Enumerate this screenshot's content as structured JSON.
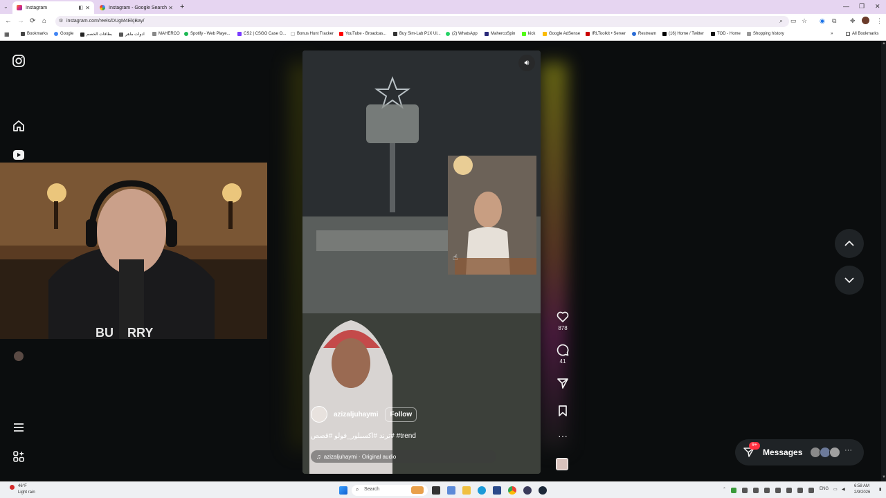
{
  "browser": {
    "tabs": [
      {
        "title": "Instagram",
        "active": true
      },
      {
        "title": "Instagram - Google Search",
        "active": false
      }
    ],
    "url": "instagram.com/reels/DUgM4EkjBay/",
    "bookmarks": [
      "Bookmarks",
      "Google",
      "بطاقات الخصم",
      "ادوات ماهر",
      "MAHERCO",
      "Spotify - Web Playe...",
      "CS2 | CSGO Case O...",
      "Bonus Hunt Tracker",
      "YouTube - Broadcas...",
      "Buy Sim-Lab P1X Ul...",
      "(2) WhatsApp",
      "MahercoSpin",
      "kick",
      "Google AdSense",
      "IRLToolkit • Server",
      "Restream",
      "(16) Home / Twitter",
      "TOD - Home",
      "Shopping history"
    ],
    "all_bookmarks": "All Bookmarks"
  },
  "webcam": {
    "shirt_text": "BU    RRY"
  },
  "reel": {
    "username": "azizaljuhaymi",
    "follow_label": "Follow",
    "caption": "ترند #اكسبلور_فولو #قصص# #trend",
    "audio": "azizaljuhaymi · Original audio"
  },
  "actions": {
    "likes": "878",
    "comments": "41"
  },
  "messages": {
    "label": "Messages",
    "badge": "9+"
  },
  "taskbar": {
    "weather_temp": "46°F",
    "weather_desc": "Light rain",
    "search_placeholder": "Search",
    "lang": "ENG",
    "time": "6:58 AM",
    "date": "2/9/2026"
  },
  "colors": {
    "page_bg": "#0b0d0e",
    "button_bg": "#1f2326",
    "badge_red": "#ff3040",
    "tab_strip": "#e6d5f1"
  }
}
